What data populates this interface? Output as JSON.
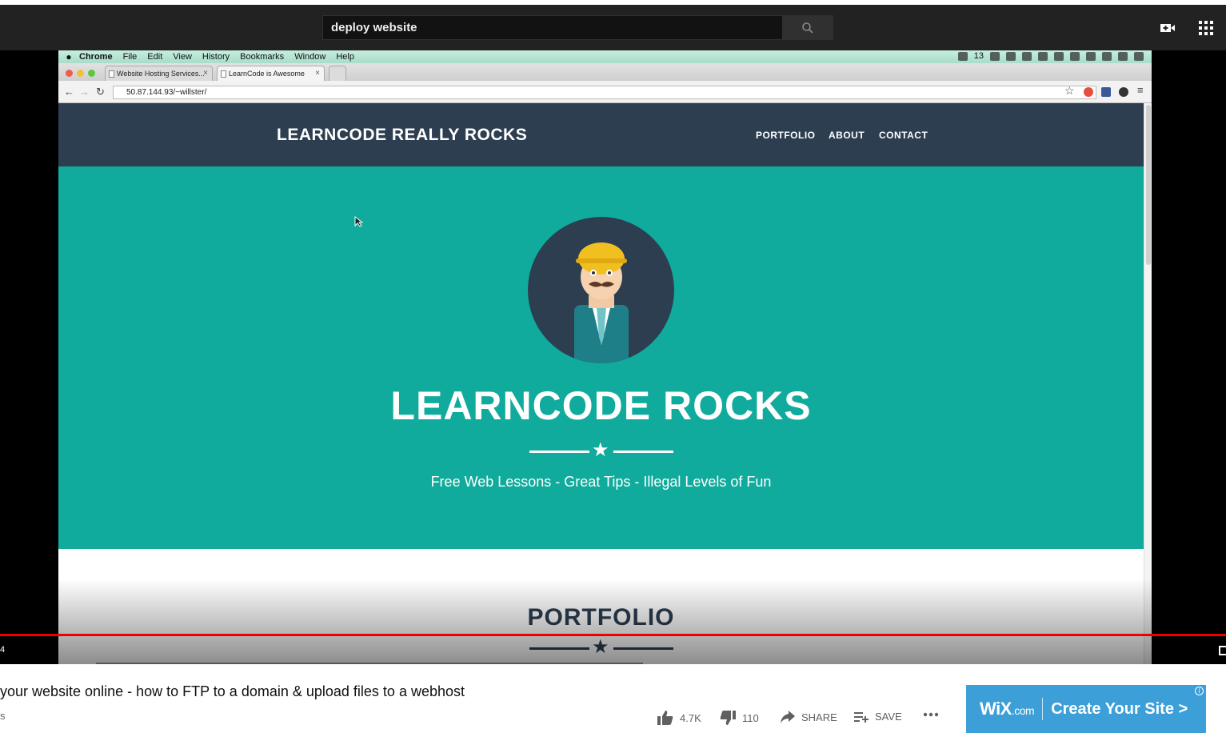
{
  "youtube": {
    "search_value": "deploy website",
    "icons": [
      "search-icon",
      "create-video-icon",
      "apps-grid-icon"
    ]
  },
  "mac_menu": {
    "items": [
      "Chrome",
      "File",
      "Edit",
      "View",
      "History",
      "Bookmarks",
      "Window",
      "Help"
    ],
    "status_count": "13"
  },
  "browser": {
    "tabs": [
      {
        "label": "Website Hosting Services..."
      },
      {
        "label": "LearnCode is Awesome"
      }
    ],
    "url": "50.87.144.93/~willster/"
  },
  "site": {
    "brand": "LEARNCODE REALLY ROCKS",
    "nav": [
      "PORTFOLIO",
      "ABOUT",
      "CONTACT"
    ],
    "hero_title": "LEARNCODE ROCKS",
    "hero_subtitle": "Free Web Lessons - Great Tips - Illegal Levels of Fun",
    "section_title": "PORTFOLIO",
    "colors": {
      "nav": "#2c3e50",
      "hero": "#10ab9c"
    }
  },
  "player": {
    "time_fragment": "4",
    "progress_played": 1.0
  },
  "video": {
    "title": "your website online - how to FTP to a domain & upload files to a webhost",
    "views_fragment": "s",
    "likes": "4.7K",
    "dislikes": "110",
    "share_label": "SHARE",
    "save_label": "SAVE"
  },
  "ad": {
    "brand": "WiX",
    "brand_suffix": ".com",
    "cta": "Create Your Site >",
    "info": "i"
  }
}
